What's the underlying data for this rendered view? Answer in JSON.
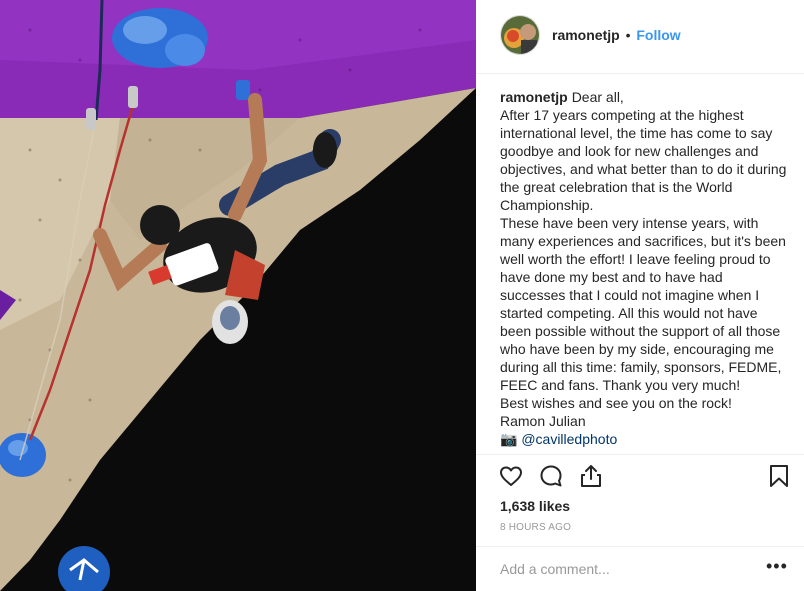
{
  "post": {
    "username": "ramonetjp",
    "separator": "•",
    "follow_label": "Follow",
    "caption_user": "ramonetjp",
    "caption_lines": [
      "Dear all,",
      "After 17 years competing at the highest international level, the time has come to say goodbye and look for new challenges and objectives, and what better than to do it during the great celebration that is the World Championship.",
      "These have been very intense years, with many experiences and sacrifices, but it's been well worth the effort! I leave feeling proud to have done my best and to have had successes that I could not imagine when I started competing. All this would not have been possible without the support of all those who have been by my side, encouraging me during all this time: family, sponsors, FEDME, FEEC and fans. Thank you very much!",
      "Best wishes and see you on the rock!",
      "Ramon Julian"
    ],
    "cut_off_line": "📷 @cavilledphoto",
    "likes": "1,638 likes",
    "timestamp": "8 HOURS AGO",
    "comment_placeholder": "Add a comment...",
    "more_label": "•••"
  },
  "icons": {
    "like": "heart-icon",
    "comment": "comment-bubble-icon",
    "share": "share-icon",
    "save": "bookmark-icon"
  },
  "colors": {
    "follow": "#3897f0",
    "wall_purple": "#8a2bb7",
    "wall_tan": "#c9b79a",
    "hold_blue": "#2e6fd8"
  }
}
